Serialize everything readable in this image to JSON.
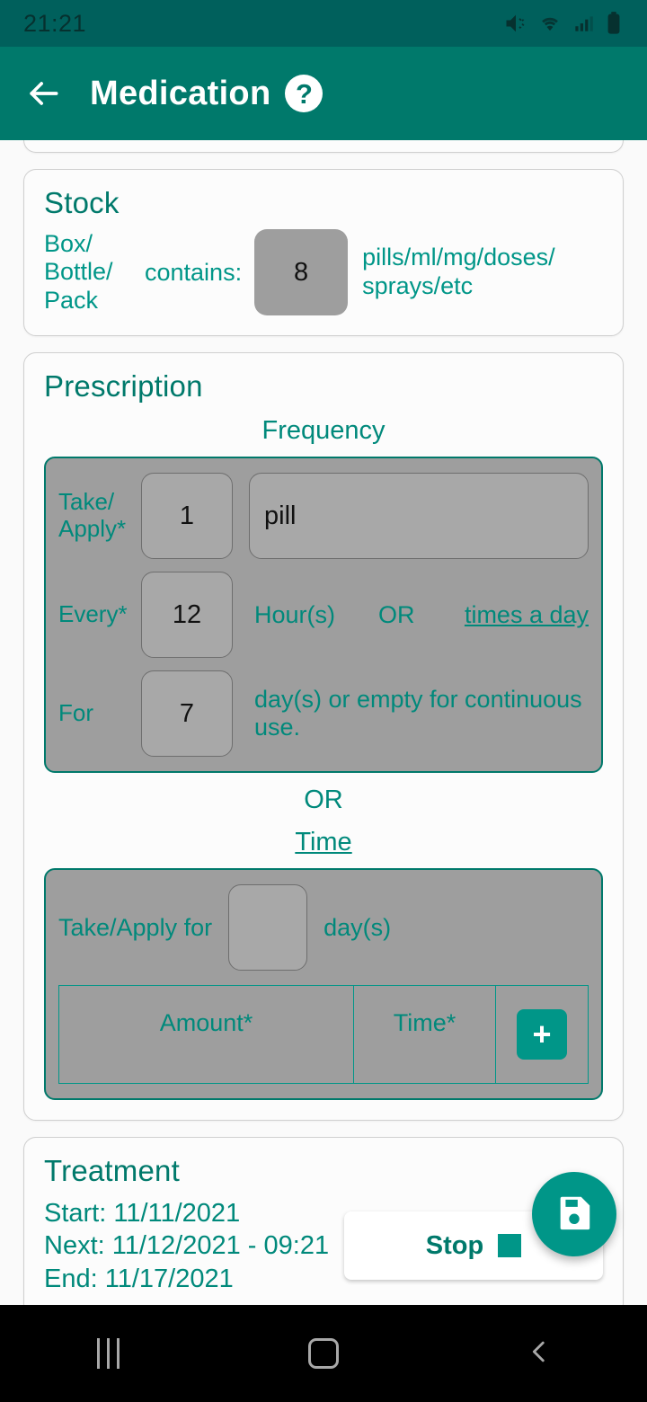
{
  "status_bar": {
    "time": "21:21",
    "icons": [
      "mute-vibrate-icon",
      "wifi-icon",
      "cellular-signal-icon",
      "battery-icon"
    ]
  },
  "app_bar": {
    "back_icon": "back-arrow-icon",
    "title": "Medication",
    "help_label": "?"
  },
  "stock": {
    "title": "Stock",
    "container_label": "Box/\nBottle/\nPack",
    "contains_label": "contains:",
    "quantity_value": "8",
    "units_label": "pills/ml/mg/doses/\nsprays/etc"
  },
  "prescription": {
    "title": "Prescription",
    "frequency_label": "Frequency",
    "frequency": {
      "take_label": "Take/\nApply*",
      "take_amount": "1",
      "take_unit": "pill",
      "every_label": "Every*",
      "every_value": "12",
      "every_unit": "Hour(s)",
      "or_label": "OR",
      "times_a_day_link": "times a day",
      "for_label": "For",
      "for_value": "7",
      "for_note": "day(s) or empty for continuous use."
    },
    "or_divider": "OR",
    "time_link": "Time",
    "time_block": {
      "take_apply_for_label": "Take/Apply for",
      "days_value": "",
      "days_unit": "day(s)",
      "table_headers": [
        "Amount*",
        "Time*"
      ],
      "add_button_label": "+"
    }
  },
  "treatment": {
    "title": "Treatment",
    "start_line": "Start: 11/11/2021",
    "next_line": "Next: 11/12/2021 - 09:21",
    "end_line": "End: 11/17/2021",
    "stop_label": "Stop"
  },
  "fab": {
    "icon": "save-floppy-icon"
  },
  "nav_bar": {
    "recents_label": "recents-icon",
    "home_label": "home-icon",
    "back_label": "back-icon"
  },
  "colors": {
    "status_bar": "#00605C",
    "app_bar": "#00796B",
    "accent": "#009688",
    "teal_text": "#00897B",
    "gray_block": "#9E9E9E",
    "page_bg": "#FAFAFA"
  }
}
